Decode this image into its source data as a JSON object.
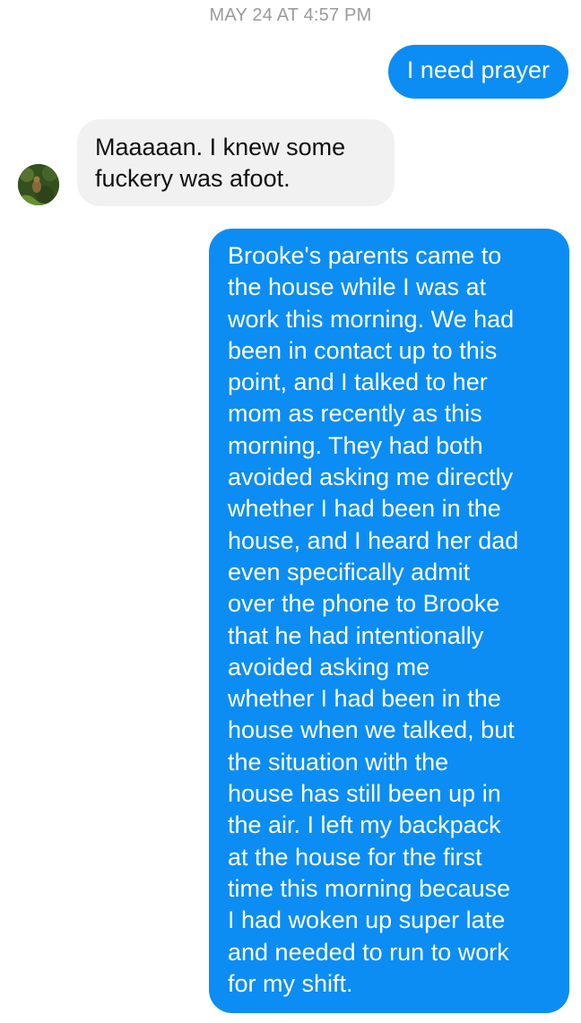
{
  "timestamp": "MAY 24 AT 4:57 PM",
  "messages": [
    {
      "direction": "outgoing",
      "lines": [
        "I need prayer"
      ]
    },
    {
      "direction": "incoming",
      "lines": [
        "Maaaaan. I knew some",
        "fuckery was afoot."
      ]
    },
    {
      "direction": "outgoing",
      "lines": [
        "Brooke's parents came to",
        "the house while I was at",
        "work this morning. We had",
        "been in contact up to this",
        "point, and I talked to her",
        "mom as recently as this",
        "morning. They had both",
        "avoided asking me directly",
        "whether I had been in the",
        "house, and I heard her dad",
        "even specifically admit",
        "over the phone to Brooke",
        "that he had intentionally",
        "avoided asking me",
        "whether I had been in the",
        "house when we talked, but",
        "the situation with the",
        "house has still been up in",
        "the air. I left my backpack",
        "at the house for the first",
        "time this morning because",
        "I had woken up super late",
        "and needed to run to work",
        "for my shift."
      ]
    }
  ],
  "contact": {
    "avatar_icon": "contact-avatar-photo"
  },
  "colors": {
    "outgoing_bubble": "#0b8df3",
    "incoming_bubble": "#f1f1f1",
    "timestamp": "#9b9b9b"
  }
}
